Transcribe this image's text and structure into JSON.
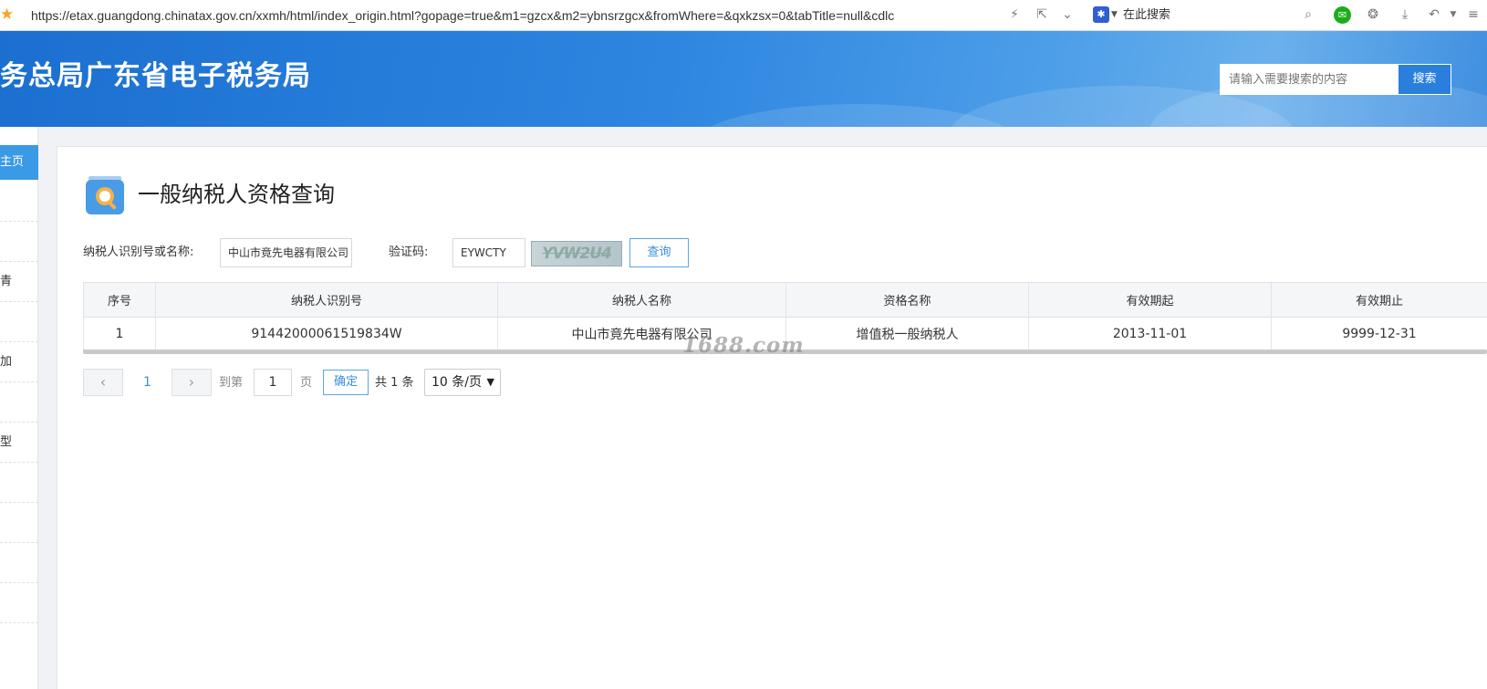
{
  "browser": {
    "url": "https://etax.guangdong.chinatax.gov.cn/xxmh/html/index_origin.html?gopage=true&m1=gzcx&m2=ybnsrzgcx&fromWhere=&qxkzsx=0&tabTitle=null&cdlc",
    "search_engine_label": "在此搜索"
  },
  "header": {
    "site_title": "务总局广东省电子税务局",
    "search_placeholder": "请输入需要搜索的内容",
    "search_button": "搜索"
  },
  "sidebar": {
    "home_label": "主页",
    "items": [
      "",
      "",
      "青",
      "",
      "加",
      "",
      "型",
      "",
      "",
      "",
      ""
    ]
  },
  "page": {
    "title": "一般纳税人资格查询"
  },
  "form": {
    "taxpayer_label": "纳税人识别号或名称:",
    "taxpayer_value": "中山市竟先电器有限公司",
    "captcha_label": "验证码:",
    "captcha_value": "EYWCTY",
    "captcha_image_text": "YVW2U4",
    "query_button": "查询"
  },
  "table": {
    "headers": [
      "序号",
      "纳税人识别号",
      "纳税人名称",
      "资格名称",
      "有效期起",
      "有效期止"
    ],
    "rows": [
      [
        "1",
        "91442000061519834W",
        "中山市竟先电器有限公司",
        "增值税一般纳税人",
        "2013-11-01",
        "9999-12-31"
      ]
    ]
  },
  "watermark": "1688.com",
  "pagination": {
    "prev_icon": "chevron-left-icon",
    "next_icon": "chevron-right-icon",
    "current_page": "1",
    "goto_prefix": "到第",
    "goto_value": "1",
    "goto_suffix": "页",
    "confirm_button": "确定",
    "total_text": "共 1 条",
    "page_size": "10 条/页"
  },
  "colors": {
    "accent": "#3a8ed8",
    "banner": "#2e86e0",
    "sidebar_active": "#3b9ae6"
  }
}
